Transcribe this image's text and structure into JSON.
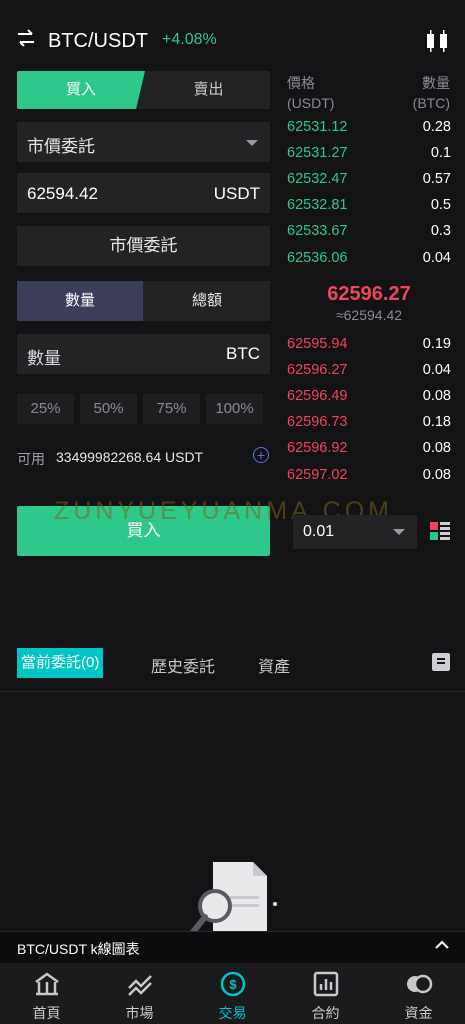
{
  "header": {
    "pair": "BTC/USDT",
    "change": "+4.08%"
  },
  "trade_tabs": {
    "buy": "買入",
    "sell": "賣出"
  },
  "order_type": {
    "selected": "市價委託"
  },
  "price_input": {
    "value": "62594.42",
    "unit": "USDT"
  },
  "market_button": "市價委託",
  "amount_mode": {
    "quantity": "數量",
    "total": "總額"
  },
  "quantity_input": {
    "label": "數量",
    "unit": "BTC"
  },
  "percents": [
    "25%",
    "50%",
    "75%",
    "100%"
  ],
  "available": {
    "label": "可用",
    "value": "33499982268.64 USDT"
  },
  "buy_button": "買入",
  "watermark": "ZUNYUEYUANMA.COM",
  "orderbook": {
    "price_header": "價格",
    "price_unit": "(USDT)",
    "qty_header": "數量",
    "qty_unit": "(BTC)",
    "asks": [
      {
        "price": "62531.12",
        "qty": "0.28"
      },
      {
        "price": "62531.27",
        "qty": "0.1"
      },
      {
        "price": "62532.47",
        "qty": "0.57"
      },
      {
        "price": "62532.81",
        "qty": "0.5"
      },
      {
        "price": "62533.67",
        "qty": "0.3"
      },
      {
        "price": "62536.06",
        "qty": "0.04"
      }
    ],
    "last_price": "62596.27",
    "approx": "≈62594.42",
    "bids": [
      {
        "price": "62595.94",
        "qty": "0.19"
      },
      {
        "price": "62596.27",
        "qty": "0.04"
      },
      {
        "price": "62596.49",
        "qty": "0.08"
      },
      {
        "price": "62596.73",
        "qty": "0.18"
      },
      {
        "price": "62596.92",
        "qty": "0.08"
      },
      {
        "price": "62597.02",
        "qty": "0.08"
      }
    ],
    "depth": "0.01"
  },
  "order_tabs": {
    "current": "當前委託(0)",
    "history": "歷史委託",
    "assets": "資產"
  },
  "kline_bar": {
    "title": "BTC/USDT k線圖表"
  },
  "nav": [
    {
      "label": "首頁",
      "icon": "home-icon"
    },
    {
      "label": "市場",
      "icon": "market-icon"
    },
    {
      "label": "交易",
      "icon": "trade-icon"
    },
    {
      "label": "合約",
      "icon": "contract-icon"
    },
    {
      "label": "資金",
      "icon": "funds-icon"
    }
  ],
  "colors": {
    "accent_green": "#2ec98a",
    "accent_red": "#f0455b",
    "accent_cyan": "#00c5c5"
  }
}
